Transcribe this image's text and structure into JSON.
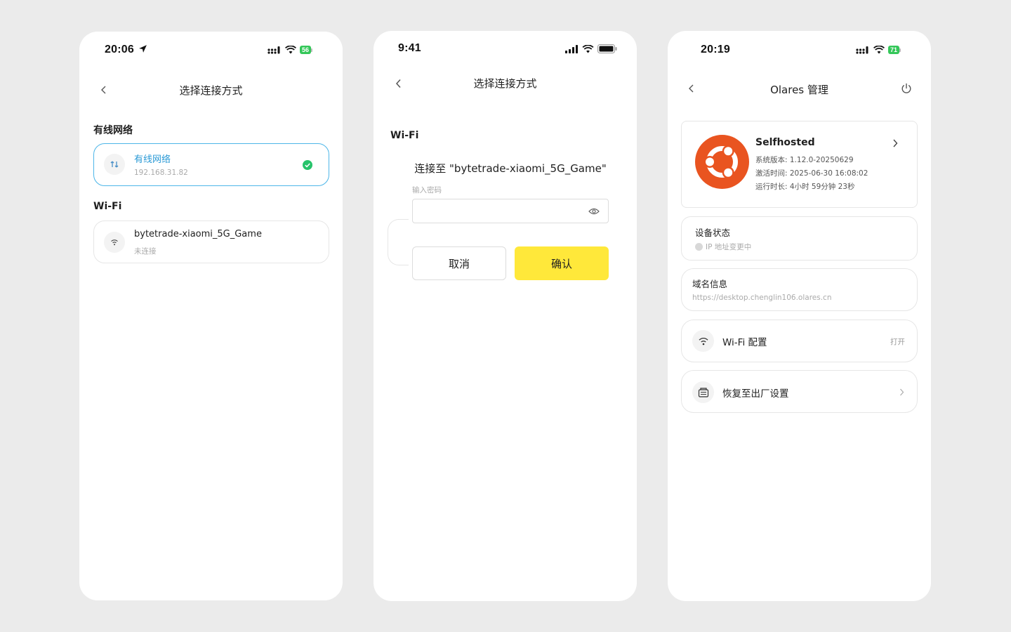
{
  "screen1": {
    "status": {
      "time": "20:06",
      "battery": "56"
    },
    "nav": {
      "title": "选择连接方式"
    },
    "wired_section_title": "有线网络",
    "wired_card": {
      "title": "有线网络",
      "subtitle": "192.168.31.82"
    },
    "wifi_section_title": "Wi-Fi",
    "wifi_card": {
      "title": "bytetrade-xiaomi_5G_Game",
      "subtitle": "未连接"
    }
  },
  "screen2": {
    "status": {
      "time": "9:41"
    },
    "nav": {
      "title": "选择连接方式"
    },
    "wifi_section_title": "Wi-Fi",
    "dialog": {
      "title": "连接至 \"bytetrade-xiaomi_5G_Game\"",
      "password_label": "输入密码",
      "password_value": "",
      "cancel_label": "取消",
      "confirm_label": "确认"
    }
  },
  "screen3": {
    "status": {
      "time": "20:19",
      "battery": "71"
    },
    "nav": {
      "title": "Olares 管理"
    },
    "device_card": {
      "name": "Selfhosted",
      "version": "系统版本: 1.12.0-20250629",
      "activated": "激活时间: 2025-06-30 16:08:02",
      "uptime": "运行时长: 4小时 59分钟 23秒"
    },
    "device_status": {
      "title": "设备状态",
      "value": "IP 地址变更中"
    },
    "domain_info": {
      "title": "域名信息",
      "value": "https://desktop.chenglin106.olares.cn"
    },
    "wifi_config": {
      "title": "Wi-Fi 配置",
      "action": "打开"
    },
    "factory_reset": {
      "title": "恢复至出厂设置"
    }
  },
  "colors": {
    "accent_blue": "#2b9ad6",
    "success_green": "#34c759",
    "confirm_yellow": "#ffe83a",
    "ubuntu_orange": "#e95420"
  }
}
